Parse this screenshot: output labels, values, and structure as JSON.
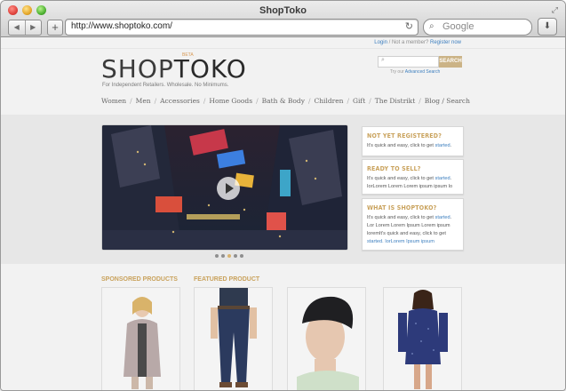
{
  "browser": {
    "window_title": "ShopToko",
    "url": "http://www.shoptoko.com/",
    "search_placeholder": "Google"
  },
  "site": {
    "top_links": {
      "login": "Login",
      "not_member": "Not a member?",
      "register": "Register now"
    },
    "logo_shop": "SHOP",
    "logo_toko": "TOKO",
    "beta": "BETA",
    "tagline": "For Independent Retailers. Wholesale. No Minimums.",
    "search_button": "SEARCH",
    "advanced_prefix": "Try our",
    "advanced_link": "Advanced Search",
    "nav": [
      "Women",
      "Men",
      "Accessories",
      "Home Goods",
      "Bath & Body",
      "Children",
      "Gift",
      "The Distrikt",
      "Blog / Search"
    ]
  },
  "hero": {
    "dots_total": 5,
    "active_dot": 3
  },
  "side_boxes": [
    {
      "title": "NOT YET REGISTERED?",
      "text": "It's quick and easy, click to get",
      "link": "started",
      "extra": ""
    },
    {
      "title": "READY TO SELL?",
      "text": "It's quick and easy, click to get",
      "link": "started",
      "extra": "IorLorem Lorem Lorem ipsum ipsum lo"
    },
    {
      "title": "WHAT IS SHOPTOKO?",
      "text": "It's quick and easy, click to get",
      "link": "started",
      "extra": "Lor Lorem Lorem Ipsum Lorem ipsum loremIt's quick and easy, click to get",
      "extra2": "started. IorLorem Ipsum ipsum"
    }
  ],
  "sections": {
    "sponsored": "SPONSORED PRODUCTS",
    "featured": "FEATURED PRODUCT"
  },
  "products": [
    {
      "name": "sponsored-product-jacket"
    },
    {
      "name": "featured-product-jeans"
    },
    {
      "name": "featured-product-beanie"
    },
    {
      "name": "featured-product-dress"
    }
  ],
  "colors": {
    "accent": "#c9a25c",
    "link": "#3d7fbf",
    "search_button": "#cbb386"
  }
}
